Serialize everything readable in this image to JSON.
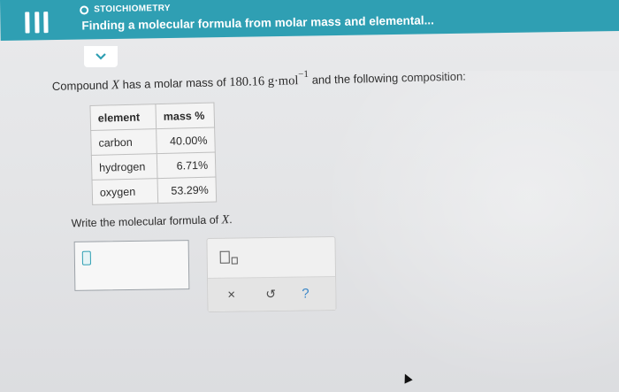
{
  "header": {
    "topic": "STOICHIOMETRY",
    "title": "Finding a molecular formula from molar mass and elemental..."
  },
  "problem": {
    "prefix": "Compound",
    "compound": "X",
    "mid": "has a molar mass of",
    "molar_mass": "180.16",
    "unit": "g·mol",
    "exponent": "−1",
    "suffix": "and the following composition:"
  },
  "table": {
    "headers": [
      "element",
      "mass %"
    ],
    "rows": [
      {
        "element": "carbon",
        "mass": "40.00%"
      },
      {
        "element": "hydrogen",
        "mass": "6.71%"
      },
      {
        "element": "oxygen",
        "mass": "53.29%"
      }
    ]
  },
  "question": {
    "text": "Write the molecular formula of",
    "var": "X",
    "end": "."
  },
  "toolbox": {
    "close": "×",
    "undo": "↺",
    "help": "?"
  },
  "colors": {
    "header": "#2f9fb3",
    "help": "#3a87c8"
  },
  "icons": [
    "menu-icon",
    "chevron-down-icon",
    "subscript-icon",
    "close-icon",
    "undo-icon",
    "help-icon"
  ]
}
